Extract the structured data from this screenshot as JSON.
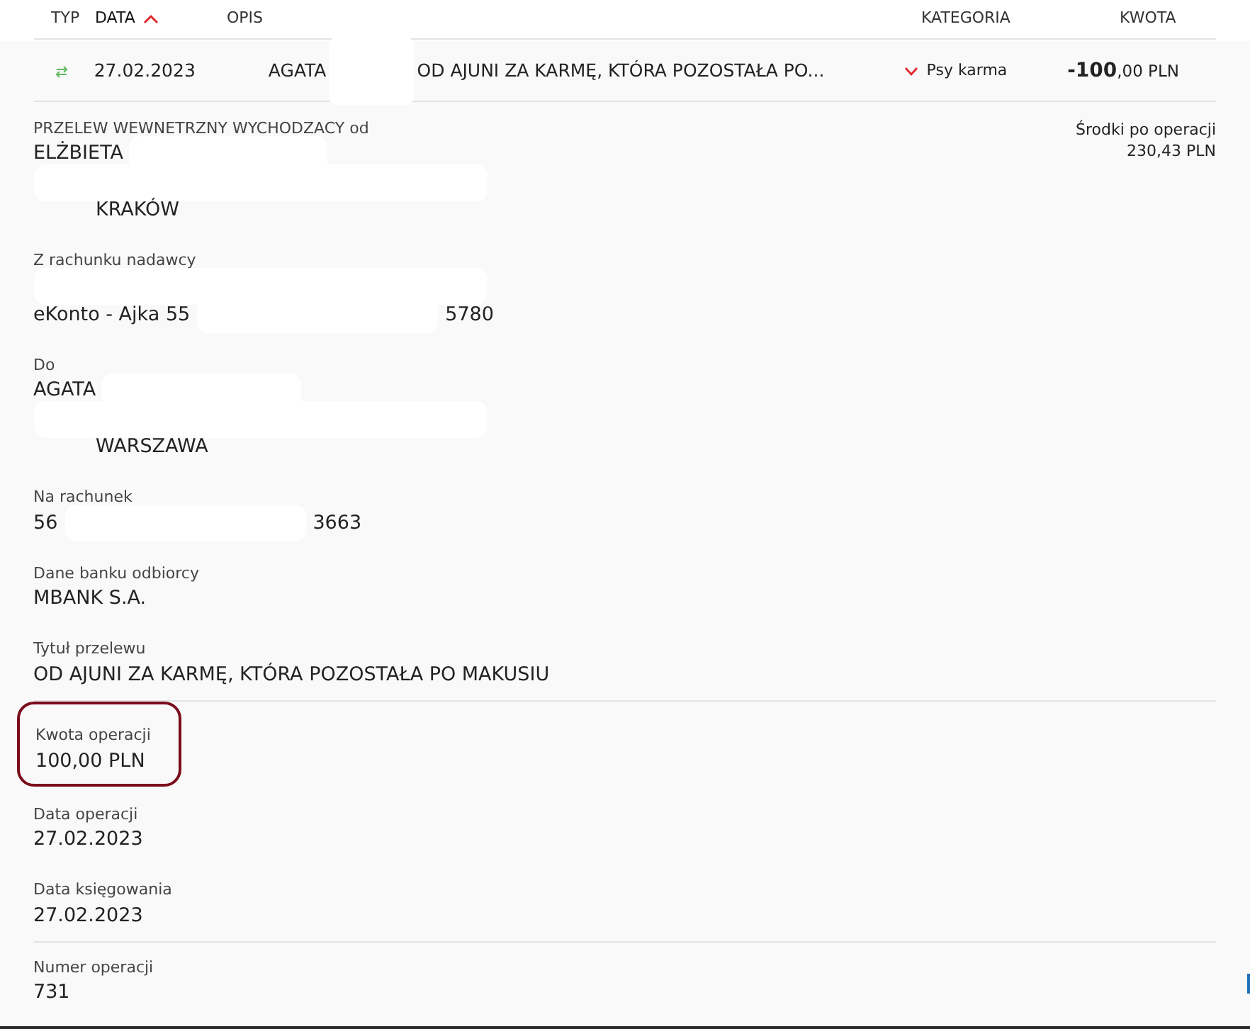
{
  "table": {
    "columns": [
      {
        "label": "TYP",
        "sorted": false
      },
      {
        "label": "DATA",
        "sorted": true
      },
      {
        "label": "OPIS",
        "sorted": false
      },
      {
        "label": "KATEGORIA",
        "sorted": false
      },
      {
        "label": "KWOTA",
        "sorted": false
      }
    ],
    "row": {
      "date": "27.02.2023",
      "description": [
        {
          "kind": "text",
          "text": "AGATA"
        },
        {
          "kind": "redacted"
        },
        {
          "kind": "text",
          "text": "OD AJUNI ZA KARMĘ, KTÓRA POZOSTAŁA PO..."
        }
      ],
      "category": "Psy karma",
      "expanded": true,
      "amount": "**-100**,00 PLN"
    }
  },
  "balance": {
    "label": "Środki po operacji",
    "value": "230,43 PLN"
  },
  "details": [
    {
      "kind": "field",
      "label": "PRZELEW WEWNETRZNY WYCHODZACY od",
      "highlighted": false,
      "lines": [
        [
          {
            "kind": "text",
            "text": "ELŻBIETA"
          },
          {
            "kind": "redacted"
          }
        ],
        [
          {
            "kind": "redacted"
          }
        ],
        [
          {
            "kind": "redacted"
          },
          {
            "kind": "text",
            "text": "KRAKÓW"
          }
        ]
      ]
    },
    {
      "kind": "field",
      "label": "Z rachunku nadawcy",
      "highlighted": false,
      "lines": [
        [
          {
            "kind": "redacted"
          }
        ],
        [
          {
            "kind": "text",
            "text": "eKonto - Ajka 55"
          },
          {
            "kind": "redacted"
          },
          {
            "kind": "text",
            "text": "5780"
          }
        ]
      ]
    },
    {
      "kind": "field",
      "label": "Do",
      "highlighted": false,
      "lines": [
        [
          {
            "kind": "text",
            "text": "AGATA"
          },
          {
            "kind": "redacted"
          }
        ],
        [
          {
            "kind": "redacted"
          }
        ],
        [
          {
            "kind": "redacted"
          },
          {
            "kind": "text",
            "text": "WARSZAWA"
          }
        ]
      ]
    },
    {
      "kind": "field",
      "label": "Na rachunek",
      "highlighted": false,
      "lines": [
        [
          {
            "kind": "text",
            "text": "56"
          },
          {
            "kind": "redacted"
          },
          {
            "kind": "text",
            "text": "3663"
          }
        ]
      ]
    },
    {
      "kind": "field",
      "label": "Dane banku odbiorcy",
      "highlighted": false,
      "lines": [
        [
          {
            "kind": "text",
            "text": "MBANK S.A."
          }
        ]
      ]
    },
    {
      "kind": "field",
      "label": "Tytuł przelewu",
      "highlighted": false,
      "lines": [
        [
          {
            "kind": "text",
            "text": "OD AJUNI ZA KARMĘ, KTÓRA POZOSTAŁA PO MAKUSIU"
          }
        ]
      ]
    },
    {
      "kind": "divider"
    },
    {
      "kind": "field",
      "label": "Kwota operacji",
      "highlighted": true,
      "lines": [
        [
          {
            "kind": "text",
            "text": "100,00 PLN"
          }
        ]
      ]
    },
    {
      "kind": "field",
      "label": "Data operacji",
      "highlighted": false,
      "lines": [
        [
          {
            "kind": "text",
            "text": "27.02.2023"
          }
        ]
      ]
    },
    {
      "kind": "field",
      "label": "Data księgowania",
      "highlighted": false,
      "lines": [
        [
          {
            "kind": "text",
            "text": "27.02.2023"
          }
        ]
      ]
    },
    {
      "kind": "divider"
    },
    {
      "kind": "field",
      "label": "Numer operacji",
      "highlighted": false,
      "lines": [
        [
          {
            "kind": "text",
            "text": "731"
          }
        ]
      ]
    }
  ]
}
